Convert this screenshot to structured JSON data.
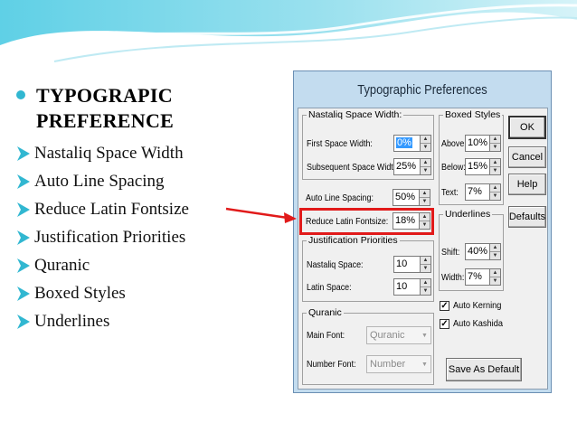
{
  "slide": {
    "heading_line1": "TYPOGRAPIC",
    "heading_line2": "PREFERENCE",
    "items": [
      "Nastaliq Space Width",
      "Auto Line Spacing",
      "Reduce Latin Fontsize",
      "Justification Priorities",
      "Quranic",
      "Boxed Styles",
      "Underlines"
    ],
    "accent_color": "#31b7d1",
    "arrow_color": "#e11a1a"
  },
  "dialog": {
    "title": "Typographic Preferences",
    "nastaliq": {
      "label": "Nastaliq Space Width:",
      "first_label": "First Space Width:",
      "first_value": "0%",
      "subsequent_label": "Subsequent Space Width:",
      "subsequent_value": "25%"
    },
    "auto_line": {
      "label": "Auto Line Spacing:",
      "value": "50%"
    },
    "reduce_latin": {
      "label": "Reduce Latin Fontsize:",
      "value": "18%"
    },
    "justification": {
      "label": "Justification Priorities",
      "nastaliq_label": "Nastaliq Space:",
      "nastaliq_value": "10",
      "latin_label": "Latin Space:",
      "latin_value": "10"
    },
    "quranic": {
      "label": "Quranic",
      "main_font_label": "Main Font:",
      "main_font_value": "Quranic",
      "number_font_label": "Number Font:",
      "number_font_value": "Number"
    },
    "boxed": {
      "label": "Boxed Styles",
      "above_label": "Above:",
      "above_value": "10%",
      "below_label": "Below:",
      "below_value": "15%",
      "text_label": "Text:",
      "text_value": "7%"
    },
    "underlines": {
      "label": "Underlines",
      "shift_label": "Shift:",
      "shift_value": "40%",
      "width_label": "Width:",
      "width_value": "7%"
    },
    "auto_kerning": {
      "label": "Auto Kerning",
      "checked": true,
      "mark": "✓"
    },
    "auto_kashida": {
      "label": "Auto Kashida",
      "checked": true,
      "mark": "✓"
    },
    "buttons": {
      "ok": "OK",
      "cancel": "Cancel",
      "help": "Help",
      "defaults": "Defaults",
      "save_default": "Save As Default"
    }
  }
}
